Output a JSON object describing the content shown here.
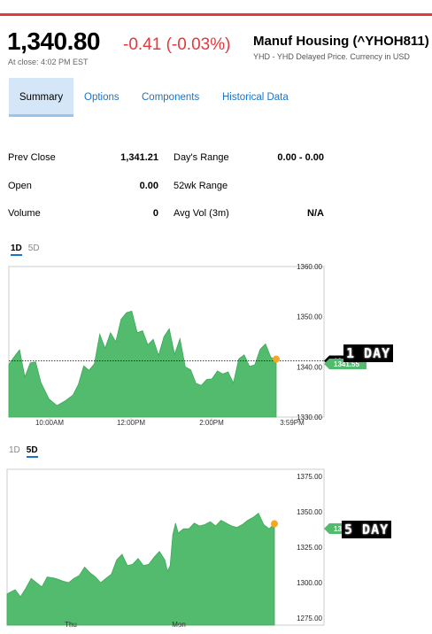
{
  "quote": {
    "price": "1,340.80",
    "change": "-0.41 (-0.03%)",
    "close_time": "At close: 4:02 PM EST",
    "name": "Manuf Housing (^YHOH811)",
    "subtitle": "YHD - YHD Delayed Price. Currency in USD"
  },
  "tabs": [
    {
      "label": "Summary",
      "active": true
    },
    {
      "label": "Options",
      "active": false
    },
    {
      "label": "Components",
      "active": false
    },
    {
      "label": "Historical Data",
      "active": false
    }
  ],
  "stats": {
    "prev_close_label": "Prev Close",
    "prev_close": "1,341.21",
    "open_label": "Open",
    "open": "0.00",
    "volume_label": "Volume",
    "volume": "0",
    "days_range_label": "Day's Range",
    "days_range": "0.00 - 0.00",
    "wk52_label": "52wk Range",
    "wk52": "",
    "avg_vol_label": "Avg Vol (3m)",
    "avg_vol": "N/A"
  },
  "chart1": {
    "toggle": [
      "1D",
      "5D"
    ],
    "active": "1D",
    "last_label": "1341.55",
    "prev_close_label": "1341.21",
    "side_label": "1 DAY"
  },
  "chart2": {
    "toggle": [
      "1D",
      "5D"
    ],
    "active": "5D",
    "last_label": "1341.55",
    "side_label": "5 DAY"
  },
  "colors": {
    "down": "#e0393e",
    "fill": "#52bb6e",
    "link": "#1a73c8",
    "marker": "#f5a623"
  },
  "chart_data": [
    {
      "type": "area",
      "title": "1D",
      "x_ticks": [
        "10:00AM",
        "12:00PM",
        "2:00PM",
        "3:59PM"
      ],
      "y_ticks": [
        1330.0,
        1340.0,
        1350.0,
        1360.0
      ],
      "ylim": [
        1330,
        1360
      ],
      "reference_line": 1341.21,
      "last_value": 1341.55,
      "x": [
        0,
        0.02,
        0.04,
        0.06,
        0.08,
        0.1,
        0.12,
        0.15,
        0.18,
        0.21,
        0.24,
        0.26,
        0.28,
        0.3,
        0.32,
        0.34,
        0.36,
        0.38,
        0.4,
        0.42,
        0.44,
        0.46,
        0.48,
        0.5,
        0.52,
        0.54,
        0.56,
        0.58,
        0.6,
        0.62,
        0.64,
        0.66,
        0.68,
        0.7,
        0.72,
        0.74,
        0.76,
        0.78,
        0.8,
        0.82,
        0.84,
        0.86,
        0.88,
        0.9,
        0.92,
        0.94,
        0.96,
        0.98,
        1.0
      ],
      "values": [
        1340.5,
        1342.0,
        1343.4,
        1338.0,
        1340.8,
        1341.0,
        1336.9,
        1333.6,
        1332.3,
        1333.2,
        1334.4,
        1336.5,
        1340.2,
        1339.3,
        1340.6,
        1346.5,
        1343.7,
        1346.8,
        1345.0,
        1349.5,
        1350.8,
        1351.1,
        1346.8,
        1347.2,
        1344.4,
        1345.5,
        1342.3,
        1346.0,
        1347.6,
        1342.5,
        1345.6,
        1340.0,
        1339.4,
        1336.7,
        1336.3,
        1337.5,
        1337.6,
        1339.2,
        1338.6,
        1339.0,
        1336.8,
        1341.6,
        1342.4,
        1340.1,
        1340.4,
        1343.5,
        1344.6,
        1341.9,
        1341.55
      ]
    },
    {
      "type": "area",
      "title": "5D",
      "x_ticks": [
        "Thu",
        "Mon"
      ],
      "y_ticks": [
        1275.0,
        1300.0,
        1325.0,
        1350.0,
        1375.0
      ],
      "ylim": [
        1270,
        1380
      ],
      "last_value": 1341.55,
      "x": [
        0,
        0.03,
        0.05,
        0.07,
        0.09,
        0.11,
        0.13,
        0.15,
        0.18,
        0.21,
        0.23,
        0.25,
        0.27,
        0.29,
        0.31,
        0.33,
        0.35,
        0.37,
        0.39,
        0.41,
        0.43,
        0.45,
        0.47,
        0.49,
        0.51,
        0.53,
        0.55,
        0.57,
        0.59,
        0.6,
        0.61,
        0.62,
        0.63,
        0.64,
        0.66,
        0.68,
        0.7,
        0.72,
        0.74,
        0.76,
        0.78,
        0.8,
        0.82,
        0.84,
        0.86,
        0.88,
        0.9,
        0.92,
        0.94,
        0.96,
        0.98,
        1.0
      ],
      "values": [
        1292,
        1295,
        1290,
        1296,
        1303,
        1300,
        1297,
        1304,
        1303,
        1301,
        1300,
        1303,
        1305,
        1311,
        1307,
        1304,
        1300,
        1303,
        1306,
        1316,
        1320,
        1312,
        1313,
        1317,
        1312,
        1313,
        1318,
        1322,
        1316,
        1308,
        1312,
        1334,
        1342,
        1335,
        1338,
        1338,
        1342,
        1340,
        1341,
        1343,
        1340,
        1344,
        1342,
        1340,
        1339,
        1341,
        1344,
        1346,
        1349,
        1341,
        1338,
        1341.55
      ]
    }
  ]
}
